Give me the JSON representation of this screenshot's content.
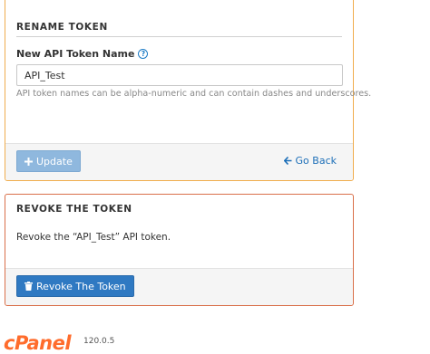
{
  "rename": {
    "title": "RENAME TOKEN",
    "field_label": "New API Token Name",
    "field_value": "API_Test",
    "help_text": "API token names can be alpha-numeric and can contain dashes and underscores.",
    "update_label": "Update",
    "go_back_label": "Go Back"
  },
  "revoke": {
    "title": "REVOKE THE TOKEN",
    "message": "Revoke the “API_Test” API token.",
    "button_label": "Revoke The Token"
  },
  "footer": {
    "brand": "cPanel",
    "version": "120.0.5"
  },
  "colors": {
    "rename_border": "#f0ad4e",
    "revoke_border": "#d9704a",
    "primary_button": "#2f79c2",
    "disabled_button": "#8fb8de",
    "link": "#1d6fb8",
    "brand": "#ff6c2c"
  },
  "icons": {
    "help": "question-circle-icon",
    "update": "plus-icon",
    "go_back": "arrow-left-icon",
    "revoke": "trash-icon"
  }
}
